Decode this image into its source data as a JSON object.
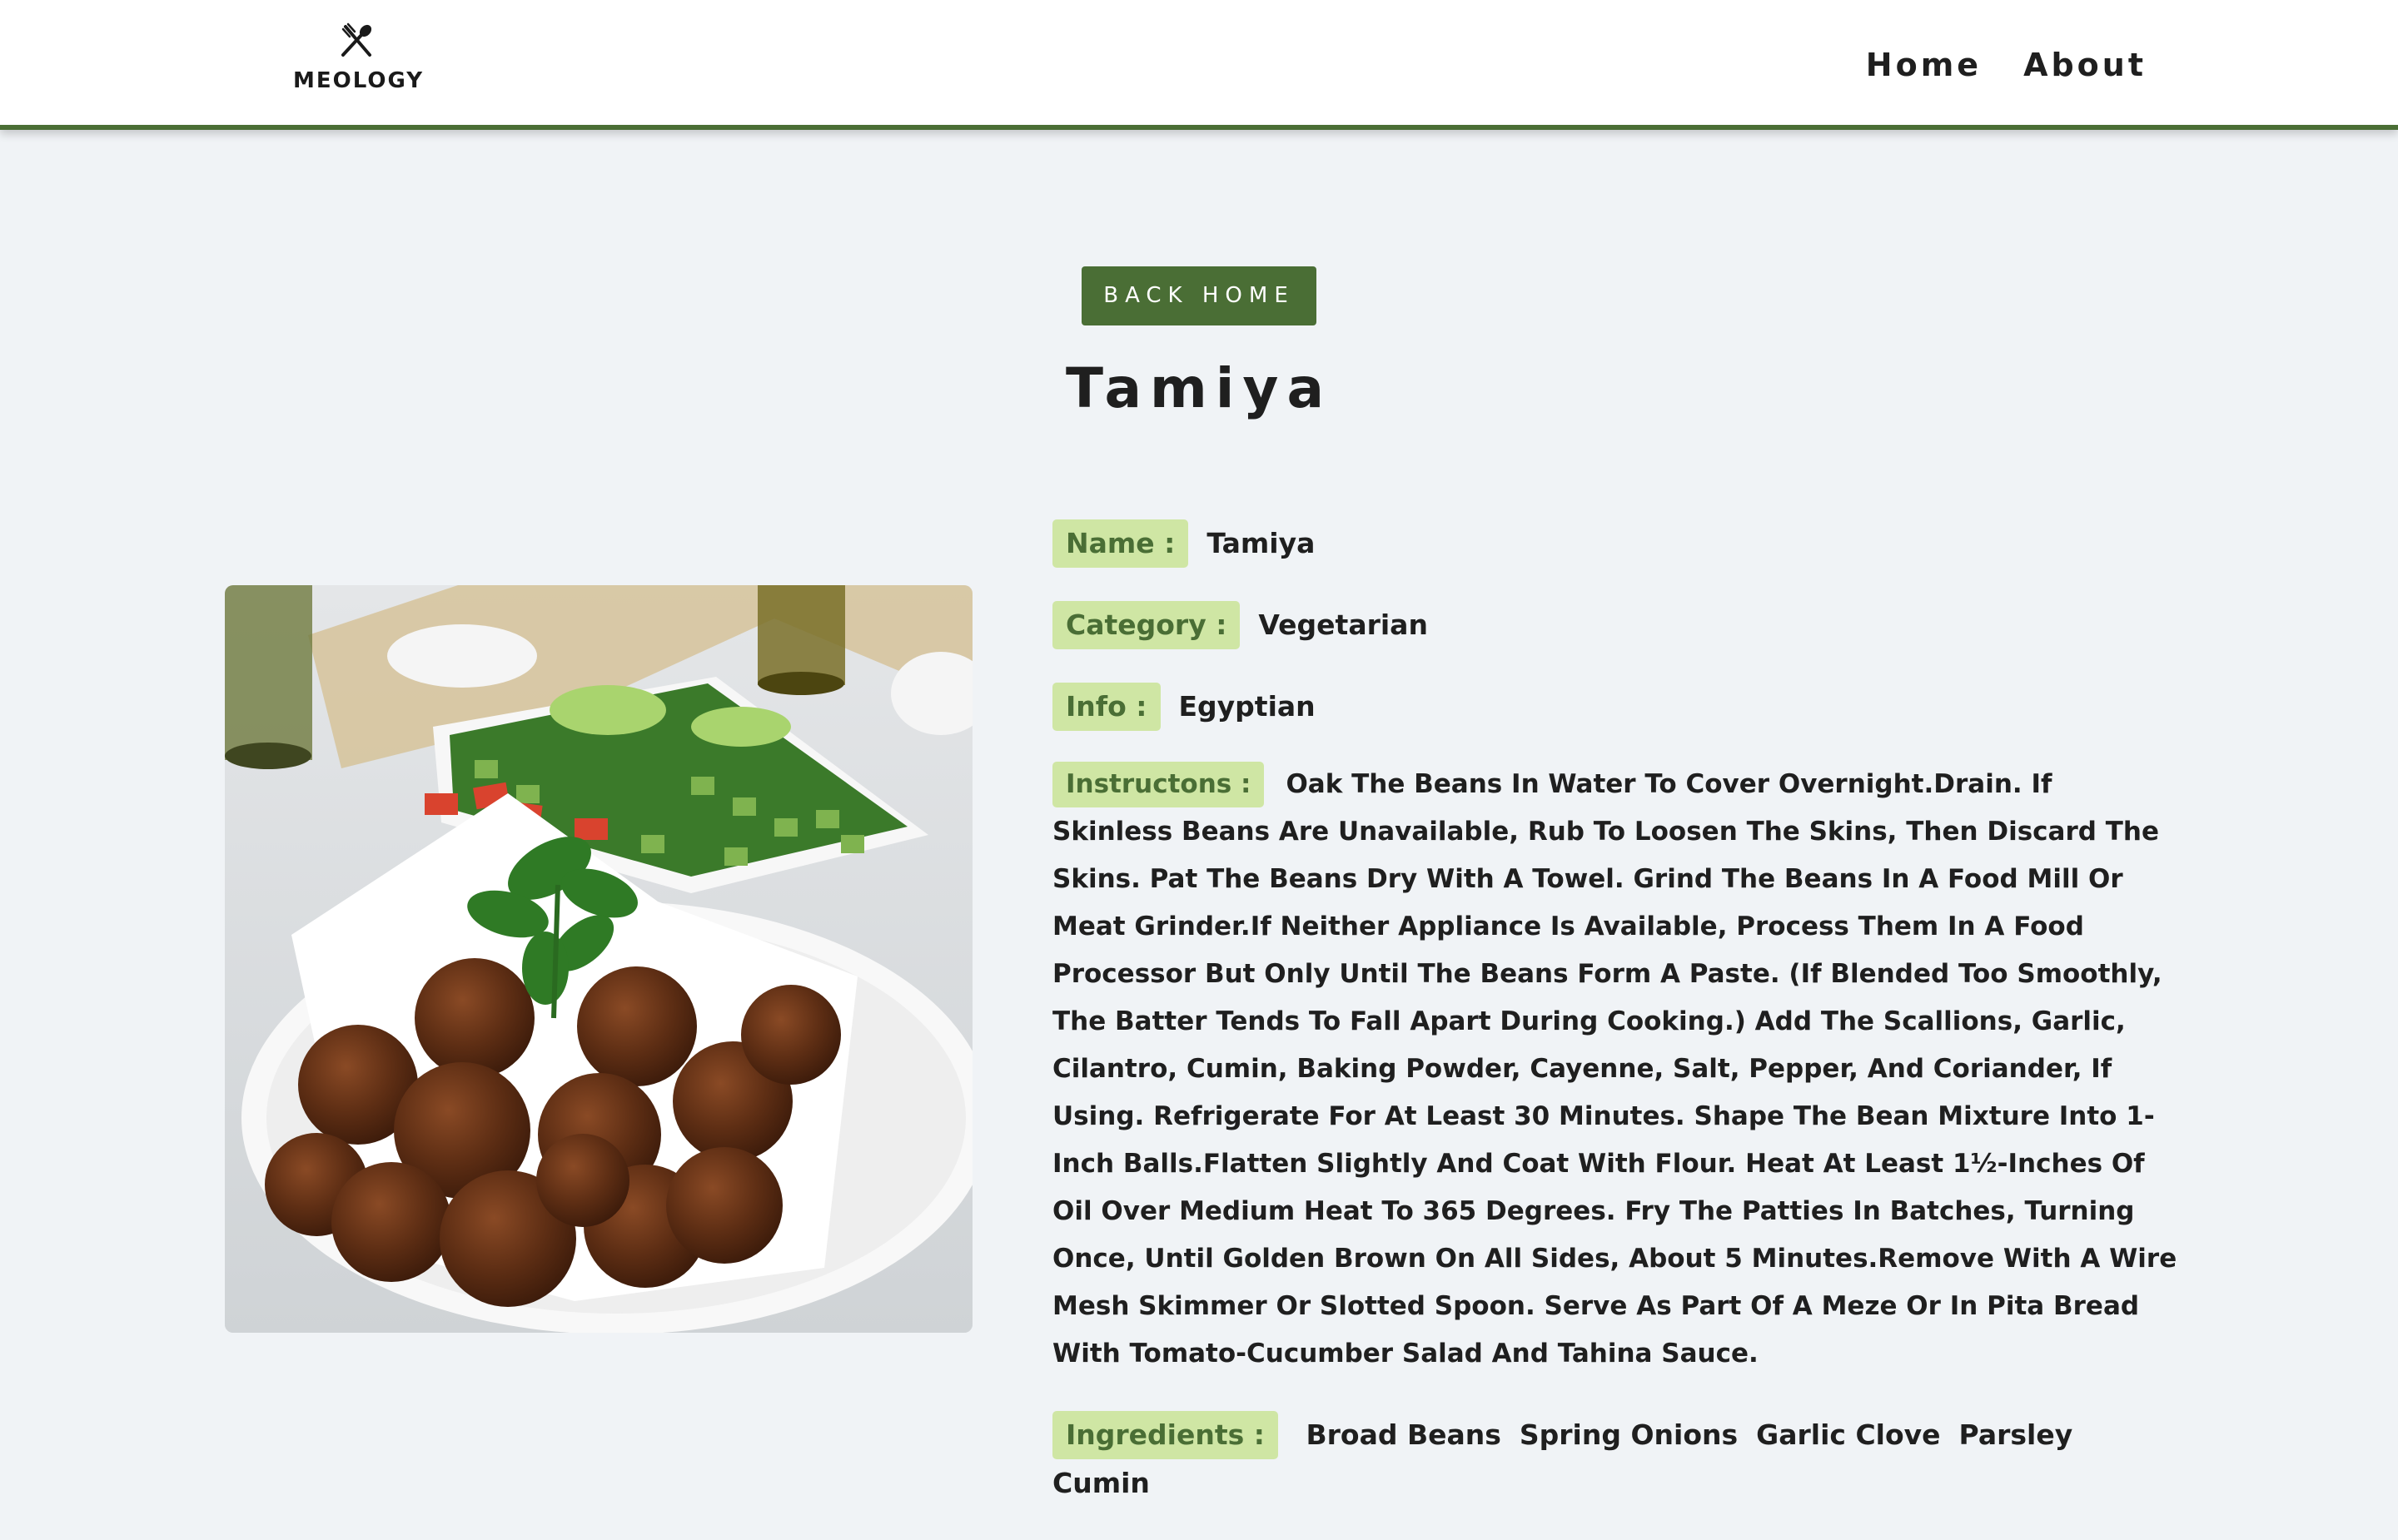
{
  "brand": {
    "name": "MEOLOGY",
    "icon": "fork-spoon-icon"
  },
  "nav": {
    "home": "Home",
    "about": "About"
  },
  "back_button": "BACK HOME",
  "page_title": "Tamiya",
  "meal": {
    "name_label": "Name :",
    "name": "Tamiya",
    "category_label": "Category :",
    "category": "Vegetarian",
    "info_label": "Info :",
    "info": "Egyptian",
    "instructions_label": "Instructons :",
    "instructions": "Oak The Beans In Water To Cover Overnight.Drain. If Skinless Beans Are Unavailable, Rub To Loosen The Skins, Then Discard The Skins. Pat The Beans Dry With A Towel. Grind The Beans In A Food Mill Or Meat Grinder.If Neither Appliance Is Available, Process Them In A Food Processor But Only Until The Beans Form A Paste. (If Blended Too Smoothly, The Batter Tends To Fall Apart During Cooking.) Add The Scallions, Garlic, Cilantro, Cumin, Baking Powder, Cayenne, Salt, Pepper, And Coriander, If Using. Refrigerate For At Least 30 Minutes. Shape The Bean Mixture Into 1-Inch Balls.Flatten Slightly And Coat With Flour. Heat At Least 1½-Inches Of Oil Over Medium Heat To 365 Degrees. Fry The Patties In Batches, Turning Once, Until Golden Brown On All Sides, About 5 Minutes.Remove With A Wire Mesh Skimmer Or Slotted Spoon. Serve As Part Of A Meze Or In Pita Bread With Tomato-Cucumber Salad And Tahina Sauce.",
    "ingredients_label": "Ingredients :",
    "ingredients": [
      "Broad Beans",
      "Spring Onions",
      "Garlic Clove",
      "Parsley",
      "Cumin"
    ]
  },
  "colors": {
    "accent": "#4a6e35",
    "label_bg": "#cfe6a4",
    "page_bg": "#f0f3f6"
  }
}
